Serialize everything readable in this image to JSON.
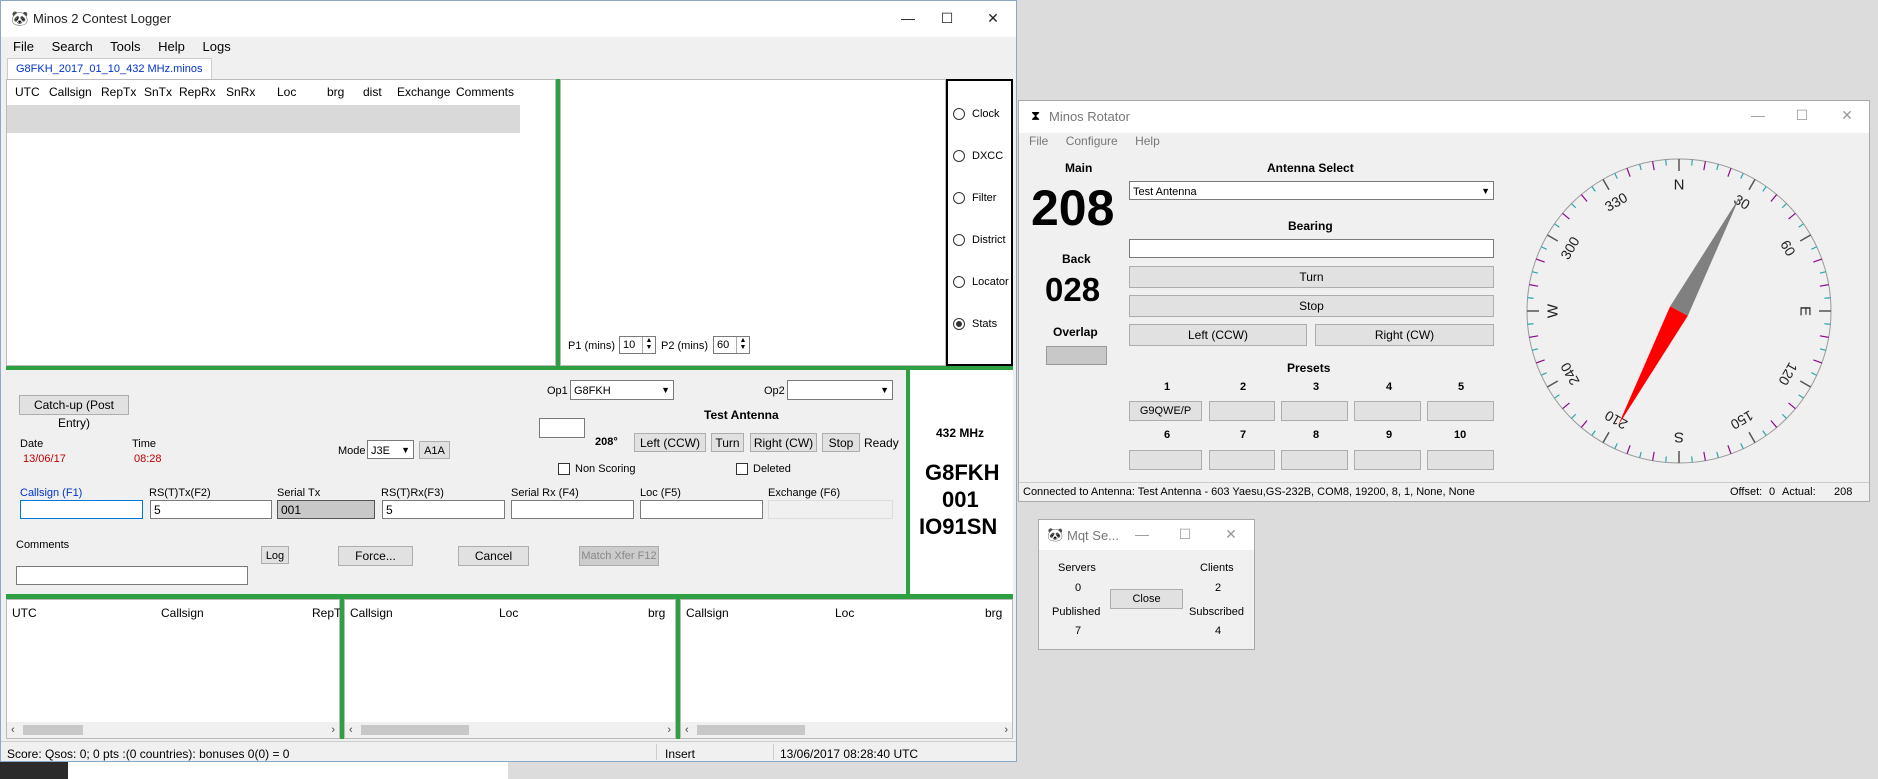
{
  "desktop": {
    "background": "#dcdcdc"
  },
  "logger": {
    "title": "Minos 2 Contest Logger",
    "menu": [
      "File",
      "Search",
      "Tools",
      "Help",
      "Logs"
    ],
    "tab": "G8FKH_2017_01_10_432 MHz.minos",
    "log_columns": [
      "UTC",
      "Callsign",
      "RepTx",
      "SnTx",
      "RepRx",
      "SnRx",
      "Loc",
      "brg",
      "dist",
      "Exchange",
      "Comments"
    ],
    "stats": {
      "p1_label": "P1 (mins)",
      "p1_value": "10",
      "p2_label": "P2 (mins)",
      "p2_value": "60"
    },
    "radio_options": [
      "Clock",
      "DXCC",
      "Filter",
      "District",
      "Locator",
      "Stats"
    ],
    "selected_option": "Stats",
    "entry": {
      "catchup_button": "Catch-up (Post Entry)",
      "op1_label": "Op1",
      "op1_value": "G8FKH",
      "op2_label": "Op2",
      "op2_value": "",
      "antenna_name": "Test Antenna",
      "bearing_value": "208°",
      "left_btn": "Left (CCW)",
      "turn_btn": "Turn",
      "right_btn": "Right (CW)",
      "stop_btn": "Stop",
      "status": "Ready",
      "date_label": "Date",
      "date_value": "13/06/17",
      "time_label": "Time",
      "time_value": "08:28",
      "mode_label": "Mode",
      "mode_value": "J3E",
      "mode_btn": "A1A",
      "non_scoring": "Non Scoring",
      "deleted": "Deleted",
      "callsign_label": "Callsign (F1)",
      "callsign_value": "",
      "rstx_label": "RS(T)Tx(F2)",
      "rstx_value": "5",
      "serialtx_label": "Serial Tx",
      "serialtx_value": "001",
      "rsrx_label": "RS(T)Rx(F3)",
      "rsrx_value": "5",
      "serialrx_label": "Serial Rx (F4)",
      "serialrx_value": "",
      "loc_label": "Loc (F5)",
      "loc_value": "",
      "exchange_label": "Exchange (F6)",
      "exchange_value": "",
      "comments_label": "Comments",
      "comments_value": "",
      "log_btn": "Log",
      "force_btn": "Force...",
      "cancel_btn": "Cancel",
      "match_btn": "Match Xfer F12"
    },
    "info": {
      "band": "432 MHz",
      "call": "G8FKH",
      "serial": "001",
      "locator": "IO91SN"
    },
    "bottom_lists": [
      {
        "columns": [
          "UTC",
          "Callsign",
          "RepT"
        ]
      },
      {
        "columns": [
          "Callsign",
          "Loc",
          "brg"
        ]
      },
      {
        "columns": [
          "Callsign",
          "Loc",
          "brg"
        ]
      }
    ],
    "statusbar": {
      "score": "Score: Qsos: 0; 0 pts :(0 countries): bonuses 0(0) = 0",
      "mode": "Insert",
      "datetime": "13/06/2017 08:28:40 UTC"
    }
  },
  "rotator": {
    "title": "Minos Rotator",
    "menu": [
      "File",
      "Configure",
      "Help"
    ],
    "main_label": "Main",
    "main_value": "208",
    "back_label": "Back",
    "back_value": "028",
    "overlap_label": "Overlap",
    "antenna_select_label": "Antenna Select",
    "antenna_value": "Test Antenna",
    "bearing_label": "Bearing",
    "bearing_value": "",
    "turn_btn": "Turn",
    "stop_btn": "Stop",
    "left_btn": "Left (CCW)",
    "right_btn": "Right (CW)",
    "presets_label": "Presets",
    "presets": [
      {
        "num": "1",
        "value": "G9QWE/P"
      },
      {
        "num": "2",
        "value": ""
      },
      {
        "num": "3",
        "value": ""
      },
      {
        "num": "4",
        "value": ""
      },
      {
        "num": "5",
        "value": ""
      },
      {
        "num": "6",
        "value": ""
      },
      {
        "num": "7",
        "value": ""
      },
      {
        "num": "8",
        "value": ""
      },
      {
        "num": "9",
        "value": ""
      },
      {
        "num": "10",
        "value": ""
      }
    ],
    "status": "Connected to Antenna: Test Antenna -   603 Yaesu,GS-232B, COM8, 19200, 8, 1, None, None",
    "offset_label": "Offset:",
    "offset_value": "0",
    "actual_label": "Actual:",
    "actual_value": "208",
    "compass": {
      "heading": 208,
      "needle_color": "#ff0000",
      "labels": [
        "N",
        "30",
        "60",
        "E",
        "120",
        "150",
        "S",
        "210",
        "240",
        "W",
        "300",
        "330"
      ]
    }
  },
  "mqt": {
    "title": "Mqt Se...",
    "servers_label": "Servers",
    "servers_value": "0",
    "clients_label": "Clients",
    "clients_value": "2",
    "published_label": "Published",
    "published_value": "7",
    "subscribed_label": "Subscribed",
    "subscribed_value": "4",
    "close_btn": "Close"
  }
}
